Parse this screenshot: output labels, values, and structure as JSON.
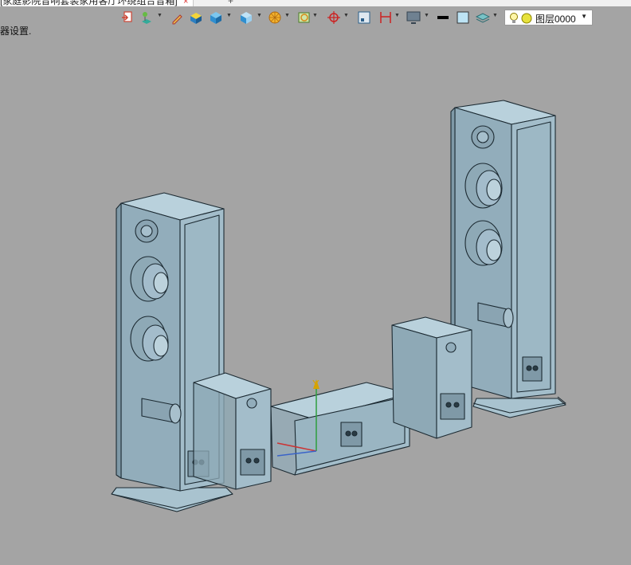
{
  "window": {
    "tab_title": "[家庭影院音响套装家用客厅环绕组合音箱]",
    "tab_close": "×",
    "tab_new": "+"
  },
  "status": {
    "text": "器设置."
  },
  "toolbar": {
    "items": [
      "viewport-icon",
      "layer-tree-icon",
      "pencil-icon",
      "solid-shade-icon",
      "cube-icon",
      "box-view-icon",
      "render-icon",
      "texture-icon",
      "snap-icon",
      "frame-icon",
      "dimension-icon",
      "monitor-icon",
      "line-style-icon",
      "color-swatch-icon",
      "layer-icon"
    ],
    "layer": {
      "label": "图层0000",
      "bulb_icon": "lightbulb-icon",
      "state_icon": "layer-on-icon"
    }
  },
  "viewport": {
    "axis_label_y": "Y",
    "colors": {
      "model_fill": "#a8c2cf",
      "model_edge": "#1c2a32",
      "background": "#a4a4a4",
      "axis_y": "#d6a300",
      "axis_x": "#cc3333",
      "axis_z": "#2e9e3e"
    }
  }
}
